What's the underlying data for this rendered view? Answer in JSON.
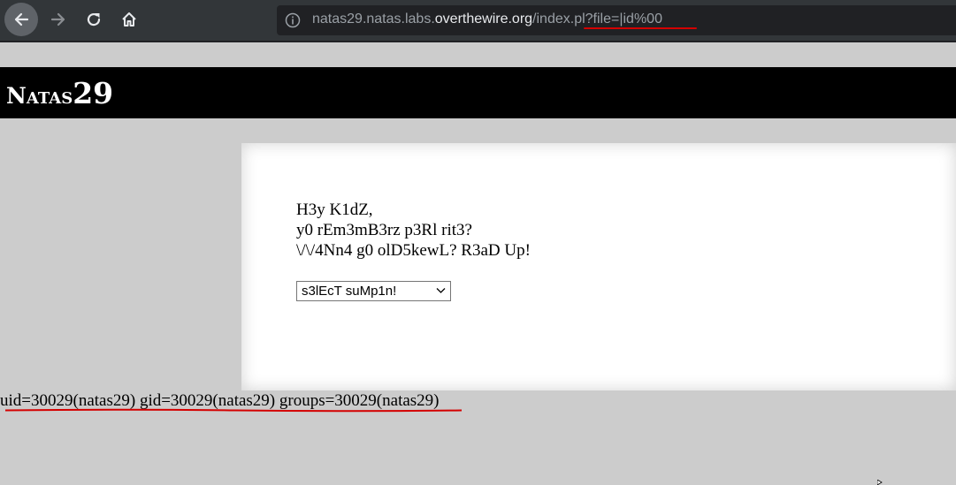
{
  "browser": {
    "url": {
      "prefix": "natas29.natas.labs.",
      "domain": "overthewire.org",
      "path": "/index.pl?file=|id%00"
    },
    "icons": {
      "back": "back-arrow-icon",
      "forward": "forward-arrow-icon",
      "reload": "reload-icon",
      "home": "home-icon",
      "site_info": "info-icon"
    }
  },
  "header": {
    "title_word": "Natas",
    "title_number": "29"
  },
  "content": {
    "lines": [
      "H3y K1dZ,",
      "y0 rEm3mB3rz p3Rl rit3?",
      "\\/\\/4Nn4 g0 olD5kewL? R3aD Up!"
    ],
    "select": {
      "selected": "s3lEcT suMp1n!"
    }
  },
  "output": {
    "text": "uid=30029(natas29) gid=30029(natas29) groups=30029(natas29)"
  },
  "colors": {
    "toolbar": "#323639",
    "omnibox": "#202124",
    "page_bg": "#cccccc",
    "header_bg": "#000000",
    "annotation_red": "#d40000"
  }
}
